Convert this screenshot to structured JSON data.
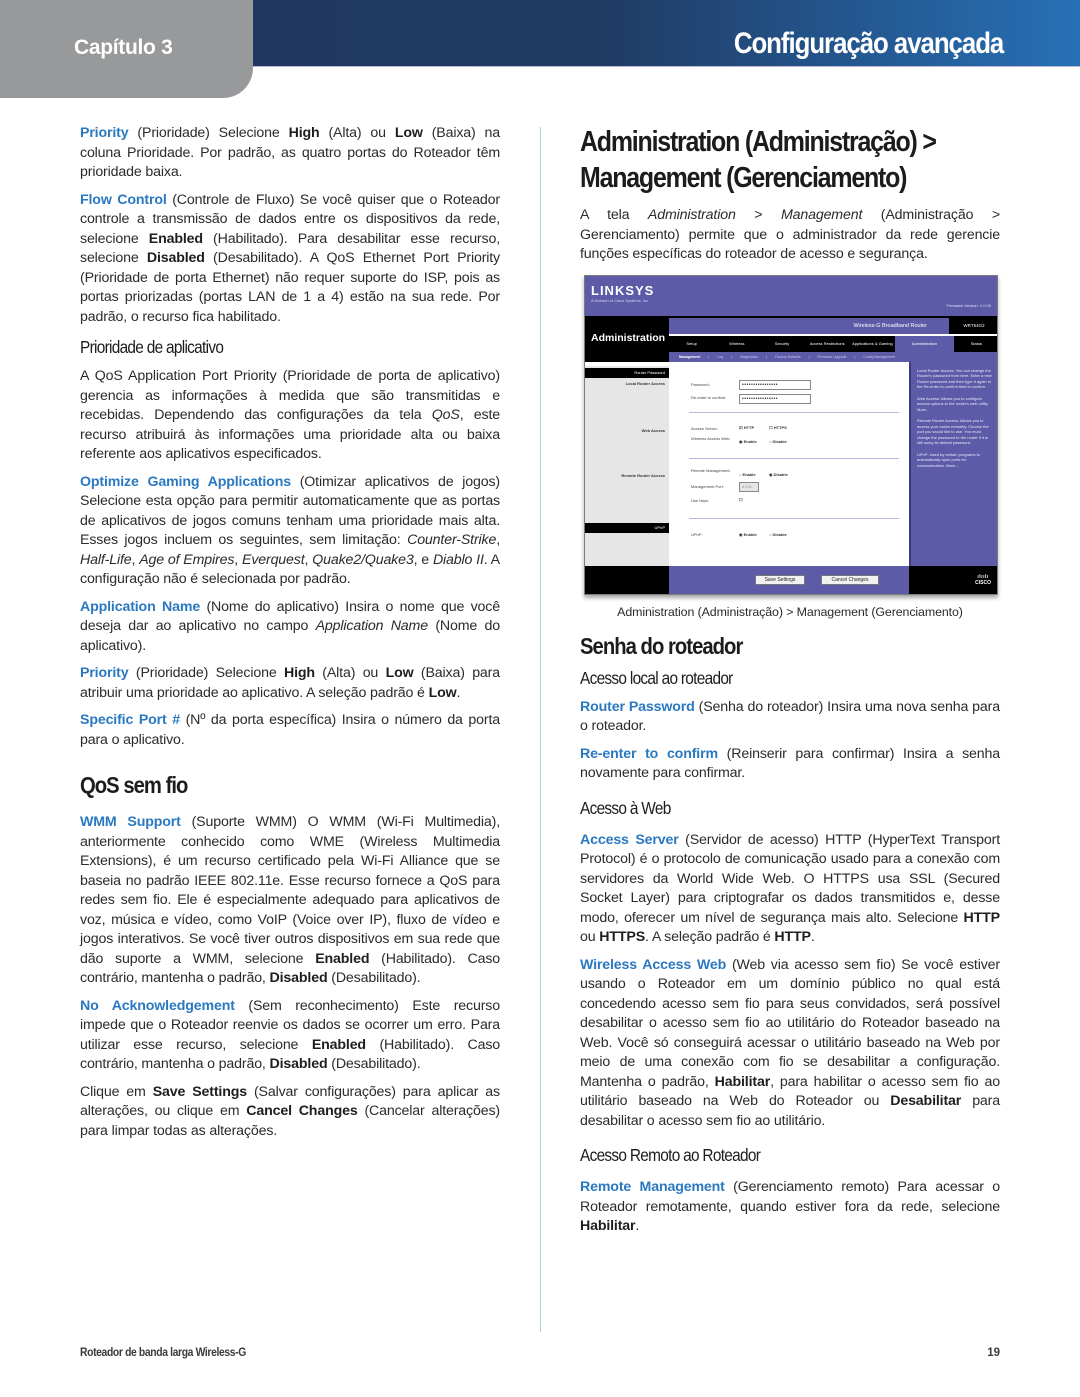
{
  "header": {
    "chapter": "Capítulo 3",
    "title": "Configuração avançada",
    "colors": {
      "bar_dark": "#1f375c",
      "bar_light": "#2770b6",
      "tab_gray": "#98999b",
      "term_blue": "#2a79c0"
    }
  },
  "left_column": {
    "priority": {
      "term": "Priority",
      "t1": " (Prioridade)  Selecione ",
      "b1": "High",
      "t2": " (Alta) ou ",
      "b2": "Low",
      "t3": " (Baixa) na coluna Prioridade. Por padrão, as quatro portas do Roteador têm prioridade baixa."
    },
    "flow_control": {
      "term": "Flow Control",
      "t1": " (Controle de Fluxo) Se você quiser que o Roteador controle a transmissão de dados entre os dispositivos da rede, selecione ",
      "b1": "Enabled",
      "t2": " (Habilitado). Para desabilitar esse recurso, selecione ",
      "b2": "Disabled",
      "t3": " (Desabilitado). A QoS Ethernet Port Priority (Prioridade de porta Ethernet) não requer suporte do ISP, pois as portas priorizadas (portas LAN de 1 a 4) estão na sua rede. Por padrão, o recurso fica habilitado."
    },
    "app_priority_heading": "Prioridade de aplicativo",
    "app_priority_intro": {
      "t1": "A QoS Application Port Priority (Prioridade de porta de aplicativo) gerencia as informações à medida que são transmitidas e recebidas. Dependendo das configurações da tela ",
      "i1": "QoS",
      "t2": ", este recurso atribuirá às informações uma prioridade alta ou baixa referente aos aplicativos especificados."
    },
    "optimize_gaming": {
      "term": "Optimize Gaming Applications",
      "t1": " (Otimizar aplicativos de jogos)  Selecione esta opção para permitir automaticamente que as portas de aplicativos de jogos comuns tenham uma prioridade mais alta. Esses jogos incluem os seguintes, sem limitação: ",
      "games": [
        "Counter-Strike",
        "Half-Life",
        "Age of Empires",
        "Everquest",
        "Quake2/Quake3",
        "Diablo II"
      ],
      "sep": ", ",
      "and": ", e ",
      "t2": ". A configuração não é selecionada por padrão."
    },
    "application_name": {
      "term": "Application Name",
      "t1": "  (Nome do aplicativo)  Insira o nome que você deseja dar ao aplicativo no campo ",
      "i1": "Application Name",
      "t2": " (Nome do aplicativo)."
    },
    "priority2": {
      "term": "Priority",
      "t1": "  (Prioridade) Selecione ",
      "b1": "High",
      "t2": " (Alta) ou ",
      "b2": "Low",
      "t3": " (Baixa) para atribuir uma prioridade ao aplicativo. A seleção padrão é ",
      "b3": "Low",
      "t4": "."
    },
    "specific_port": {
      "term": "Specific Port #",
      "t1": "  (Nº da porta específica)  Insira o número da porta para o aplicativo."
    },
    "qos_wireless_heading": "QoS sem fio",
    "wmm_support": {
      "term": "WMM Support",
      "t1": "  (Suporte WMM)  O WMM (Wi-Fi Multimedia), anteriormente conhecido como WME (Wireless Multimedia Extensions), é um recurso certificado pela Wi-Fi Alliance que se baseia no padrão IEEE 802.11e. Esse recurso fornece a QoS para redes sem fio. Ele é especialmente adequado para aplicativos de voz, música e vídeo, como VoIP (Voice over IP), fluxo de vídeo e jogos interativos. Se você tiver outros dispositivos em sua rede que dão suporte a WMM, selecione ",
      "b1": "Enabled",
      "t2": " (Habilitado). Caso contrário, mantenha o padrão, ",
      "b2": "Disabled",
      "t3": " (Desabilitado)."
    },
    "no_ack": {
      "term": "No Acknowledgement",
      "t1": "  (Sem reconhecimento) Este recurso impede que o Roteador reenvie os dados se ocorrer um erro. Para utilizar esse recurso, selecione ",
      "b1": "Enabled",
      "t2": " (Habilitado). Caso contrário, mantenha o padrão, ",
      "b2": "Disabled",
      "t3": " (Desabilitado)."
    },
    "save_cancel": {
      "t1": "Clique em ",
      "b1": "Save Settings",
      "t2": " (Salvar configurações) para aplicar as alterações, ou clique em ",
      "b2": "Cancel Changes",
      "t3": " (Cancelar alterações) para limpar todas as alterações."
    }
  },
  "right_column": {
    "title_line1": "Administration (Administração) >",
    "title_line2": "Management (Gerenciamento)",
    "intro": {
      "t1": "A tela ",
      "i1": "Administration",
      "t2": " > ",
      "i2": "Management",
      "t3": " (Administração > Gerenciamento) permite que o administrador da rede gerencie funções específicas do roteador de acesso e segurança."
    },
    "screenshot": {
      "logo": "LINKSYS",
      "logo_sub": "A Division of Cisco Systems, Inc.",
      "firmware": "Firmware Version: 1.0.00",
      "product_name": "Wireless-G Broadband Router",
      "model": "WRT54G2",
      "section_title": "Administration",
      "tabs": [
        "Setup",
        "Wireless",
        "Security",
        "Access Restrictions",
        "Applications & Gaming",
        "Administration",
        "Status"
      ],
      "active_tab": "Administration",
      "subtabs": [
        "Management",
        "|",
        "Log",
        "|",
        "Diagnostics",
        "|",
        "Factory Defaults",
        "|",
        "Firmware Upgrade",
        "|",
        "Config Management"
      ],
      "active_subtab": "Management",
      "sections": {
        "router_password": "Router Password",
        "local_router_access": "Local Router Access",
        "web_access": "Web Access",
        "remote_router_access": "Remote Router Access",
        "upnp": "UPnP"
      },
      "fields": {
        "password_label": "Password:",
        "password_value": "••••••••••••••••",
        "reenter_label": "Re-enter to confirm:",
        "reenter_value": "••••••••••••••••",
        "access_server_label": "Access Server:",
        "http_label": "HTTP",
        "http_checked": true,
        "https_label": "HTTPS",
        "https_checked": false,
        "wireless_access_label": "Wireless Access Web:",
        "wireless_access_value": "Enable",
        "remote_mgmt_label": "Remote Management:",
        "remote_mgmt_value": "Disable",
        "mgmt_port_label": "Management Port:",
        "mgmt_port_value": "8080",
        "use_https_label": "Use https:",
        "upnp_label": "UPnP:",
        "upnp_value": "Enable",
        "enable_label": "Enable",
        "disable_label": "Disable"
      },
      "help": [
        "Local Router Access: You can change the Router's password from here. Enter a new Router password and then type it again in the Re-enter to confirm field to confirm.",
        "Web Access: Allows you to configure access options to the router's web utility. More...",
        "Remote Router Access: Allows you to access your router remotely. Choose the port you would like to use. You must change the password to the router if it is still using its default password.",
        "UPnP: Used by certain programs to automatically open ports for communication. More..."
      ],
      "save_button": "Save Settings",
      "cancel_button": "Cancel Changes",
      "cisco": "CISCO"
    },
    "caption": "Administration (Administração) > Management (Gerenciamento)",
    "router_password_heading": "Senha do roteador",
    "local_access_heading": "Acesso local ao roteador",
    "router_password": {
      "term": "Router Password",
      "t1": " (Senha do roteador) Insira uma nova senha para o roteador."
    },
    "reenter": {
      "term": "Re-enter to confirm",
      "t1": "  (Reinserir para confirmar) Insira a senha novamente para confirmar."
    },
    "web_access_heading": "Acesso à Web",
    "access_server": {
      "term": "Access Server",
      "t1": " (Servidor de acesso) HTTP (HyperText Transport Protocol) é o protocolo de comunicação usado para a conexão com servidores da World Wide Web. O HTTPS usa SSL (Secured Socket Layer) para criptografar os dados transmitidos e, desse modo, oferecer um nível de segurança mais alto. Selecione ",
      "b1": "HTTP",
      "t2": " ou ",
      "b2": "HTTPS",
      "t3": ". A seleção padrão é ",
      "b3": "HTTP",
      "t4": "."
    },
    "wireless_access_web": {
      "term": "Wireless Access Web",
      "t1": " (Web via acesso sem fio) Se você estiver usando o Roteador em um domínio público no qual está concedendo acesso sem fio para seus convidados, será possível desabilitar o acesso sem fio ao utilitário do Roteador baseado na Web. Você só conseguirá acessar o utilitário baseado na Web por meio de uma conexão com fio se desabilitar a configuração. Mantenha o padrão, ",
      "b1": "Habilitar",
      "t2": ", para habilitar o acesso sem fio ao utilitário baseado na Web do Roteador ou ",
      "b2": "Desabilitar",
      "t3": " para desabilitar o acesso sem fio ao utilitário."
    },
    "remote_access_heading": "Acesso Remoto ao Roteador",
    "remote_management": {
      "term": "Remote Management",
      "t1": " (Gerenciamento remoto) Para acessar o Roteador remotamente, quando estiver fora da rede, selecione ",
      "b1": "Habilitar",
      "t2": "."
    }
  },
  "footer": {
    "product": "Roteador de banda larga Wireless-G",
    "page_number": "19"
  }
}
